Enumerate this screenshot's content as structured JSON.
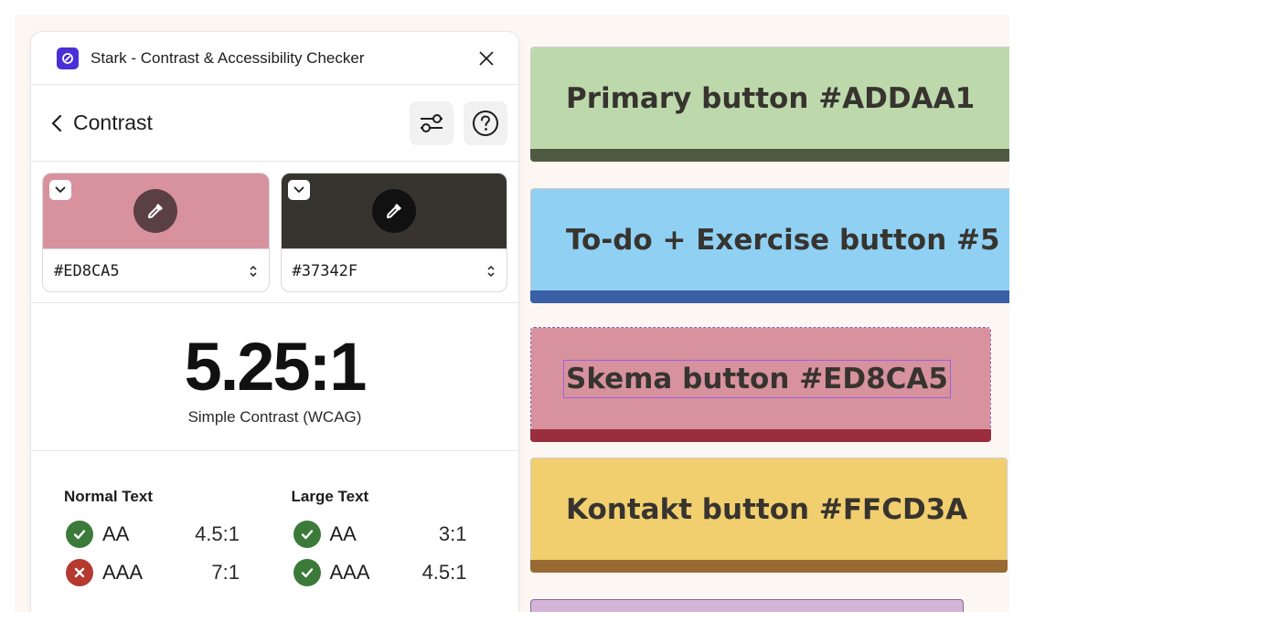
{
  "app": {
    "title": "Stark - Contrast & Accessibility Checker",
    "logo_icon": "stark-logo-icon"
  },
  "header": {
    "page_title": "Contrast",
    "settings_icon": "sliders-icon",
    "help_icon": "help-circle-icon"
  },
  "swatches": {
    "foreground": {
      "hex": "#ED8CA5",
      "display_color": "#d7929e"
    },
    "background": {
      "hex": "#37342F",
      "display_color": "#37342f"
    }
  },
  "contrast": {
    "ratio": "5.25:1",
    "label": "Simple Contrast (WCAG)"
  },
  "results": {
    "normal": {
      "heading": "Normal Text",
      "rows": [
        {
          "level": "AA",
          "threshold": "4.5:1",
          "status": "pass"
        },
        {
          "level": "AAA",
          "threshold": "7:1",
          "status": "fail"
        }
      ]
    },
    "large": {
      "heading": "Large Text",
      "rows": [
        {
          "level": "AA",
          "threshold": "3:1",
          "status": "pass"
        },
        {
          "level": "AAA",
          "threshold": "4.5:1",
          "status": "pass"
        }
      ]
    }
  },
  "canvas": {
    "buttons": [
      {
        "label": "Primary button #ADDAA1",
        "color": "#bdd9ac"
      },
      {
        "label": "To-do + Exercise button #5",
        "color": "#8fd0f3"
      },
      {
        "label": "Skema button #ED8CA5",
        "color": "#d7929e",
        "selected": true
      },
      {
        "label": "Kontakt button #FFCD3A",
        "color": "#f2cf6e"
      },
      {
        "label": "",
        "color": "#d4b3d8"
      }
    ]
  },
  "colors": {
    "pass": "#3c7a3a",
    "fail": "#b5392f",
    "brand": "#4b2fd6"
  }
}
